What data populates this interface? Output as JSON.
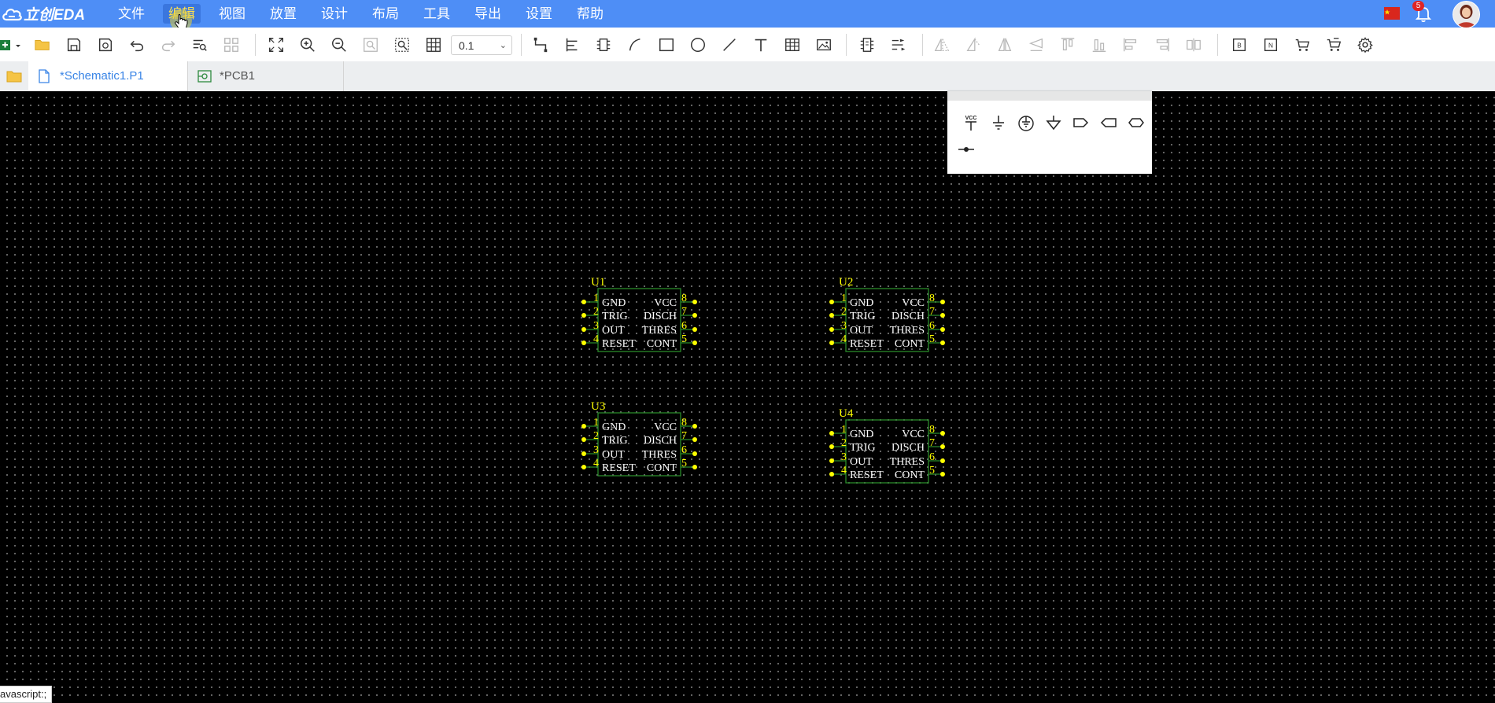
{
  "app": {
    "logo_text": "立创EDA"
  },
  "menu": [
    {
      "key": "file",
      "label": "文件",
      "active": false
    },
    {
      "key": "edit",
      "label": "编辑",
      "active": true
    },
    {
      "key": "view",
      "label": "视图",
      "active": false
    },
    {
      "key": "place",
      "label": "放置",
      "active": false
    },
    {
      "key": "design",
      "label": "设计",
      "active": false
    },
    {
      "key": "layout",
      "label": "布局",
      "active": false
    },
    {
      "key": "tools",
      "label": "工具",
      "active": false
    },
    {
      "key": "export",
      "label": "导出",
      "active": false
    },
    {
      "key": "settings",
      "label": "设置",
      "active": false
    },
    {
      "key": "help",
      "label": "帮助",
      "active": false
    }
  ],
  "notifications": {
    "count": "5"
  },
  "toolbar": {
    "zoom_value": "0.1",
    "icons": [
      "new-doc-icon",
      "open-folder-icon",
      "save-icon",
      "save-as-icon",
      "undo-icon",
      "redo-icon",
      "find-icon",
      "component-grid-icon",
      "fit-view-icon",
      "zoom-in-icon",
      "zoom-out-icon",
      "zoom-area-icon",
      "zoom-selected-icon",
      "grid-icon",
      "wire-icon",
      "bus-icon",
      "bus-entry-icon",
      "arc-icon",
      "rectangle-icon",
      "circle-icon",
      "line-icon",
      "text-icon",
      "table-icon",
      "image-icon",
      "netlabel-icon",
      "netflag-icon",
      "flip-h-icon",
      "flip-v-icon",
      "rotate-icon",
      "align-left-icon",
      "align-top-icon",
      "align-bottom-icon",
      "align-hcenter-icon",
      "align-vcenter-icon",
      "distribute-icon",
      "bom-icon",
      "netlist-icon",
      "pcb-convert-icon",
      "library-icon",
      "settings-gear-icon"
    ]
  },
  "tabs": [
    {
      "label": "*Schematic1.P1",
      "active": true
    },
    {
      "label": "*PCB1",
      "active": false
    }
  ],
  "components": [
    {
      "designator": "U1",
      "pins_left": [
        "1",
        "2",
        "3",
        "4"
      ],
      "pins_right": [
        "8",
        "7",
        "6",
        "5"
      ],
      "rows": [
        [
          "GND",
          "VCC"
        ],
        [
          "TRIG",
          "DISCH"
        ],
        [
          "OUT",
          "THRES"
        ],
        [
          "RESET",
          "CONT"
        ]
      ]
    },
    {
      "designator": "U2",
      "pins_left": [
        "1",
        "2",
        "3",
        "4"
      ],
      "pins_right": [
        "8",
        "7",
        "6",
        "5"
      ],
      "rows": [
        [
          "GND",
          "VCC"
        ],
        [
          "TRIG",
          "DISCH"
        ],
        [
          "OUT",
          "THRES"
        ],
        [
          "RESET",
          "CONT"
        ]
      ]
    },
    {
      "designator": "U3",
      "pins_left": [
        "1",
        "2",
        "3",
        "4"
      ],
      "pins_right": [
        "8",
        "7",
        "6",
        "5"
      ],
      "rows": [
        [
          "GND",
          "VCC"
        ],
        [
          "TRIG",
          "DISCH"
        ],
        [
          "OUT",
          "THRES"
        ],
        [
          "RESET",
          "CONT"
        ]
      ]
    },
    {
      "designator": "U4",
      "pins_left": [
        "1",
        "2",
        "3",
        "4"
      ],
      "pins_right": [
        "8",
        "7",
        "6",
        "5"
      ],
      "rows": [
        [
          "GND",
          "VCC"
        ],
        [
          "TRIG",
          "DISCH"
        ],
        [
          "OUT",
          "THRES"
        ],
        [
          "RESET",
          "CONT"
        ]
      ]
    }
  ],
  "palette": {
    "items": [
      {
        "name": "vcc-flag-icon",
        "label": "VCC"
      },
      {
        "name": "ground-icon"
      },
      {
        "name": "earth-ground-icon"
      },
      {
        "name": "analog-ground-icon"
      },
      {
        "name": "net-port-in-icon"
      },
      {
        "name": "net-port-out-icon"
      },
      {
        "name": "net-port-bidir-icon"
      },
      {
        "name": "no-connect-icon"
      }
    ]
  },
  "statusbar": {
    "url": "avascript:;"
  },
  "colors": {
    "menubar": "#4e8ef6",
    "canvas": "#000000",
    "grid_dot": "#6e6e6e",
    "symbol_body": "#2a8b2a",
    "pin_text": "#ffff00",
    "pin_name_text": "#ffffff",
    "tab_active_text": "#3a85e6"
  }
}
